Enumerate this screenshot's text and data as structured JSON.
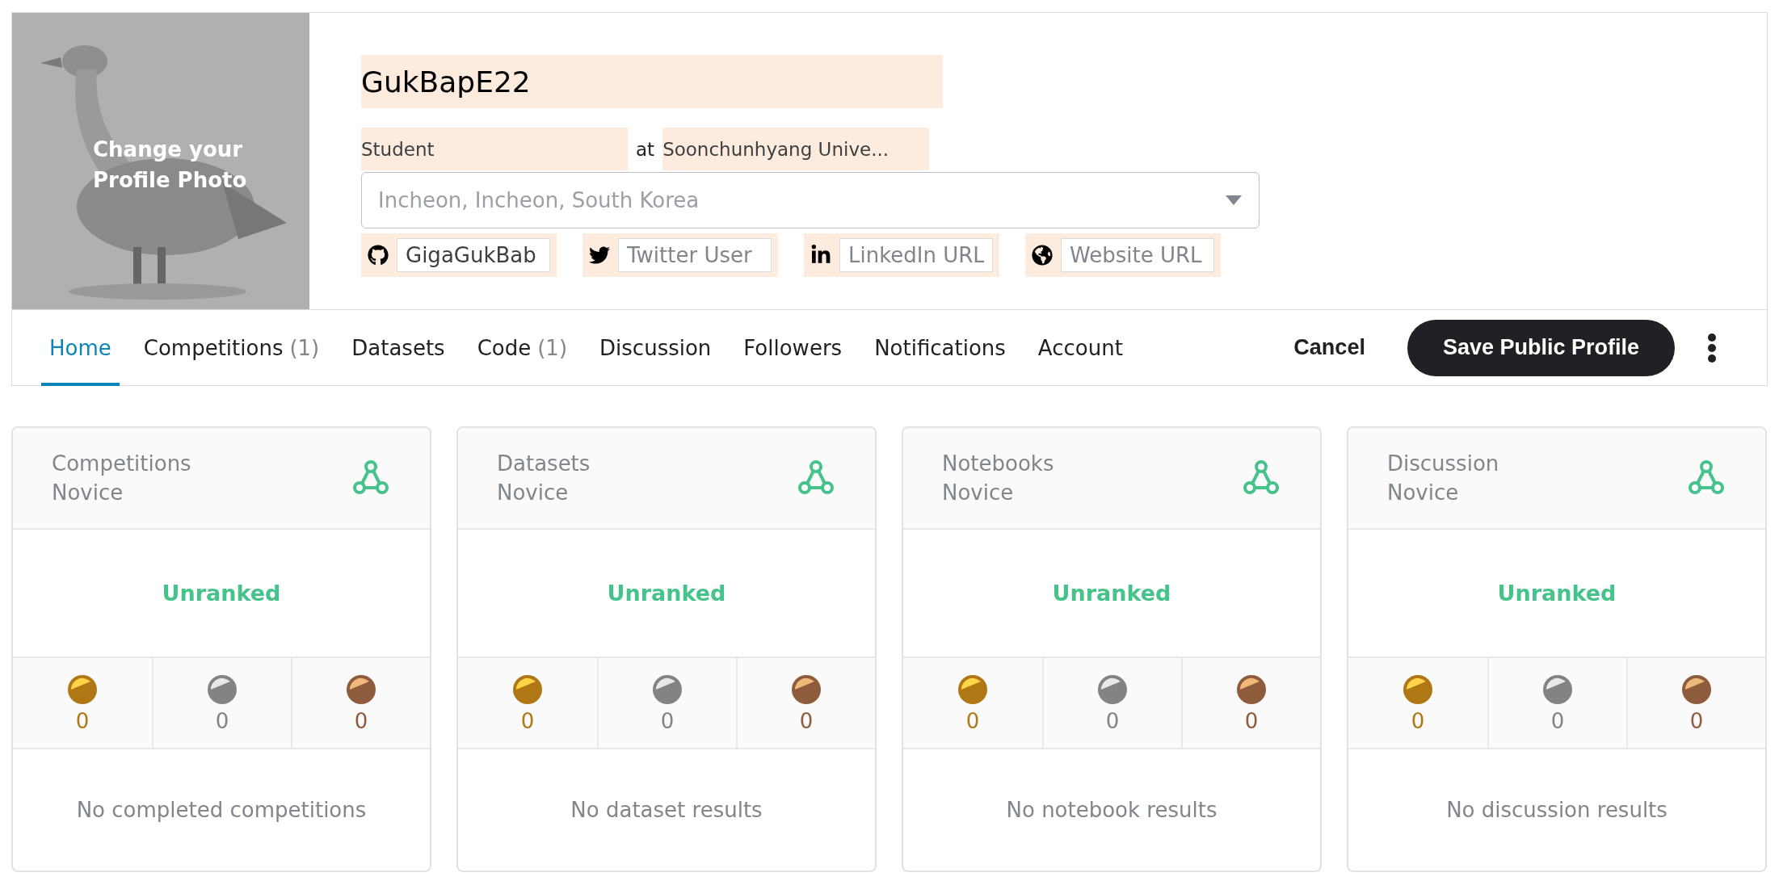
{
  "profile": {
    "photo_caption": "Change your Profile Photo",
    "name": "GukBapE22",
    "occupation": "Student",
    "at": "at",
    "organization": "Soonchunhyang Unive...",
    "location": {
      "placeholder": "Incheon, Incheon, South Korea"
    },
    "socials": [
      {
        "kind": "github",
        "value": "GigaGukBab"
      },
      {
        "kind": "twitter",
        "placeholder": "Twitter User"
      },
      {
        "kind": "linkedin",
        "placeholder": "LinkedIn URL"
      },
      {
        "kind": "website",
        "placeholder": "Website URL"
      }
    ]
  },
  "tabs": [
    {
      "label": "Home",
      "selected": true
    },
    {
      "label": "Competitions",
      "count": "(1)",
      "selected": false
    },
    {
      "label": "Datasets",
      "selected": false
    },
    {
      "label": "Code",
      "count": "(1)",
      "selected": false
    },
    {
      "label": "Discussion",
      "selected": false
    },
    {
      "label": "Followers",
      "selected": false
    },
    {
      "label": "Notifications",
      "selected": false
    },
    {
      "label": "Account",
      "selected": false
    }
  ],
  "actions": {
    "cancel": "Cancel",
    "save": "Save Public Profile"
  },
  "cards": [
    {
      "category": "Competitions",
      "tier": "Novice",
      "rank": "Unranked",
      "medals": [
        {
          "kind": "gold",
          "count": "0"
        },
        {
          "kind": "silver",
          "count": "0"
        },
        {
          "kind": "bronze",
          "count": "0"
        }
      ],
      "empty": "No completed competitions"
    },
    {
      "category": "Datasets",
      "tier": "Novice",
      "rank": "Unranked",
      "medals": [
        {
          "kind": "gold",
          "count": "0"
        },
        {
          "kind": "silver",
          "count": "0"
        },
        {
          "kind": "bronze",
          "count": "0"
        }
      ],
      "empty": "No dataset results"
    },
    {
      "category": "Notebooks",
      "tier": "Novice",
      "rank": "Unranked",
      "medals": [
        {
          "kind": "gold",
          "count": "0"
        },
        {
          "kind": "silver",
          "count": "0"
        },
        {
          "kind": "bronze",
          "count": "0"
        }
      ],
      "empty": "No notebook results"
    },
    {
      "category": "Discussion",
      "tier": "Novice",
      "rank": "Unranked",
      "medals": [
        {
          "kind": "gold",
          "count": "0"
        },
        {
          "kind": "silver",
          "count": "0"
        },
        {
          "kind": "bronze",
          "count": "0"
        }
      ],
      "empty": "No discussion results"
    }
  ]
}
